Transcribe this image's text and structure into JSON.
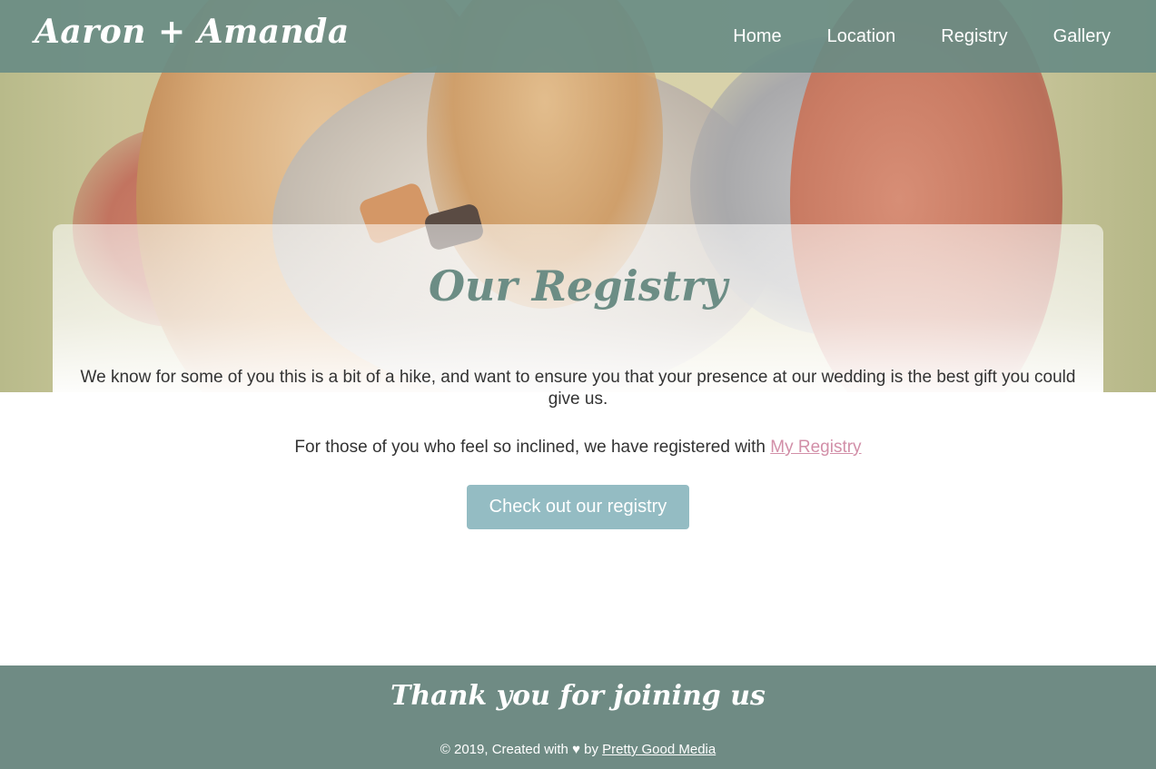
{
  "header": {
    "brand": "Aaron + Amanda",
    "nav": [
      "Home",
      "Location",
      "Registry",
      "Gallery"
    ]
  },
  "main": {
    "title": "Our Registry",
    "intro": "We know for some of you this is a bit of a hike, and want to ensure you that your presence at our wedding is the best gift you could give us.",
    "registered_text": "For those of you who feel so inclined, we have registered with ",
    "registry_link": "My Registry",
    "cta_label": "Check out our registry"
  },
  "footer": {
    "title": "Thank you for joining us",
    "note_prefix": "© 2019, Created with ♥ by ",
    "credit_link": "Pretty Good Media"
  },
  "colors": {
    "header_bg": "#698c84",
    "footer_bg": "#6f8b84",
    "accent_title": "#6c8d85",
    "button_bg": "#94bcc3",
    "link": "#d28fa8"
  }
}
